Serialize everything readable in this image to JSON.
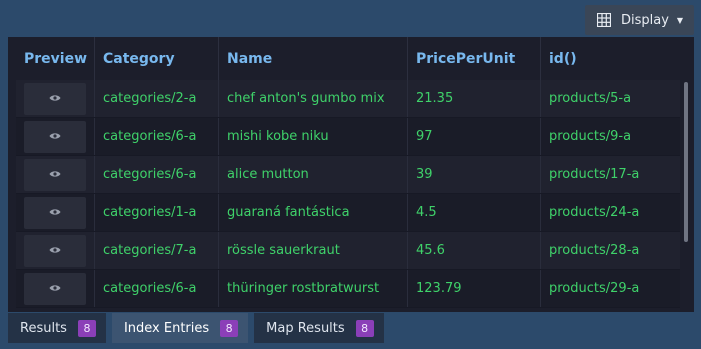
{
  "toolbar": {
    "display_label": "Display"
  },
  "table": {
    "columns": [
      "Preview",
      "Category",
      "Name",
      "PricePerUnit",
      "id()"
    ],
    "rows": [
      {
        "category": "categories/2-a",
        "name": "chef anton's gumbo mix",
        "price": "21.35",
        "id": "products/5-a"
      },
      {
        "category": "categories/6-a",
        "name": "mishi kobe niku",
        "price": "97",
        "id": "products/9-a"
      },
      {
        "category": "categories/6-a",
        "name": "alice mutton",
        "price": "39",
        "id": "products/17-a"
      },
      {
        "category": "categories/1-a",
        "name": "guaraná fantástica",
        "price": "4.5",
        "id": "products/24-a"
      },
      {
        "category": "categories/7-a",
        "name": "rössle sauerkraut",
        "price": "45.6",
        "id": "products/28-a"
      },
      {
        "category": "categories/6-a",
        "name": "thüringer rostbratwurst",
        "price": "123.79",
        "id": "products/29-a"
      }
    ]
  },
  "tabs": [
    {
      "label": "Results",
      "count": "8"
    },
    {
      "label": "Index Entries",
      "count": "8"
    },
    {
      "label": "Map Results",
      "count": "8"
    }
  ],
  "colors": {
    "accent_text": "#3fd26a",
    "header_text": "#78b8ee",
    "badge": "#8b3fb8"
  }
}
